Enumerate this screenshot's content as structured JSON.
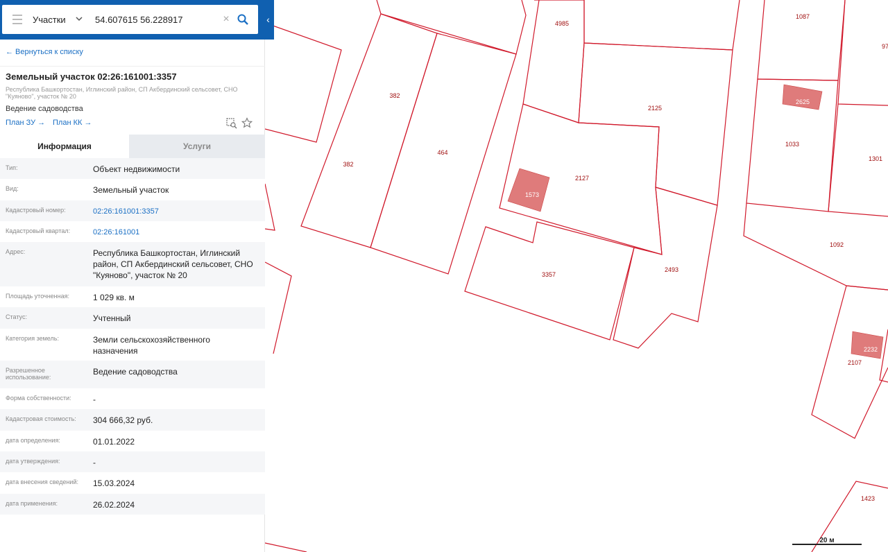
{
  "search": {
    "layer": "Участки",
    "value": "54.607615 56.228917",
    "clear_glyph": "×",
    "collapse_glyph": "‹"
  },
  "sidebar": {
    "back_label": "← Вернуться к списку",
    "title": "Земельный участок 02:26:161001:3357",
    "address": "Республика Башкортостан, Иглинский район, СП Акбердинский сельсовет, СНО \"Куяново\", участок № 20",
    "usage": "Ведение садоводства",
    "plan_zu": "План ЗУ →",
    "plan_kk": "План КК →"
  },
  "tabs": {
    "info": "Информация",
    "services": "Услуги"
  },
  "properties": [
    {
      "key": "Тип:",
      "value": "Объект недвижимости",
      "h": 30
    },
    {
      "key": "Вид:",
      "value": "Земельный участок",
      "h": 31
    },
    {
      "key": "Кадастровый номер:",
      "value": "02:26:161001:3357",
      "link": true,
      "h": 30
    },
    {
      "key": "Кадастровый квартал:",
      "value": "02:26:161001",
      "link": true,
      "h": 30
    },
    {
      "key": "Адрес:",
      "value": "Республика Башкортостан, Иглинский район, СП Акбердинский сельсовет, СНО \"Куяново\", участок № 20",
      "h": 64
    },
    {
      "key": "Площадь уточненная:",
      "value": "1 029 кв. м",
      "h": 30
    },
    {
      "key": "Статус:",
      "value": "Учтенный",
      "h": 31
    },
    {
      "key": "Категория земель:",
      "value": "Земли сельскохозяйственного назначения",
      "h": 46
    },
    {
      "key": "Разрешенное использование:",
      "value": "Ведение садоводства",
      "h": 40
    },
    {
      "key": "Форма собственности:",
      "value": "-",
      "h": 30
    },
    {
      "key": "Кадастровая стоимость:",
      "value": "304 666,32 руб.",
      "h": 31
    },
    {
      "key": "дата определения:",
      "value": "01.01.2022",
      "h": 30
    },
    {
      "key": "дата утверждения:",
      "value": "-",
      "h": 30
    },
    {
      "key": "дата внесения сведений:",
      "value": "15.03.2024",
      "h": 31
    },
    {
      "key": "дата применения:",
      "value": "26.02.2024",
      "h": 30
    }
  ],
  "map": {
    "parcel_labels": [
      "4985",
      "1087",
      "97",
      "382",
      "382",
      "464",
      "2125",
      "2625",
      "1033",
      "1301",
      "2127",
      "1573",
      "1092",
      "3357",
      "2493",
      "2232",
      "2107",
      "1423"
    ],
    "scale_label": "20 м",
    "colors": {
      "parcel_stroke": "#d0182a",
      "building_fill": "#df7b7b",
      "header_bg": "#1060b0",
      "link": "#1a6fc4"
    }
  }
}
